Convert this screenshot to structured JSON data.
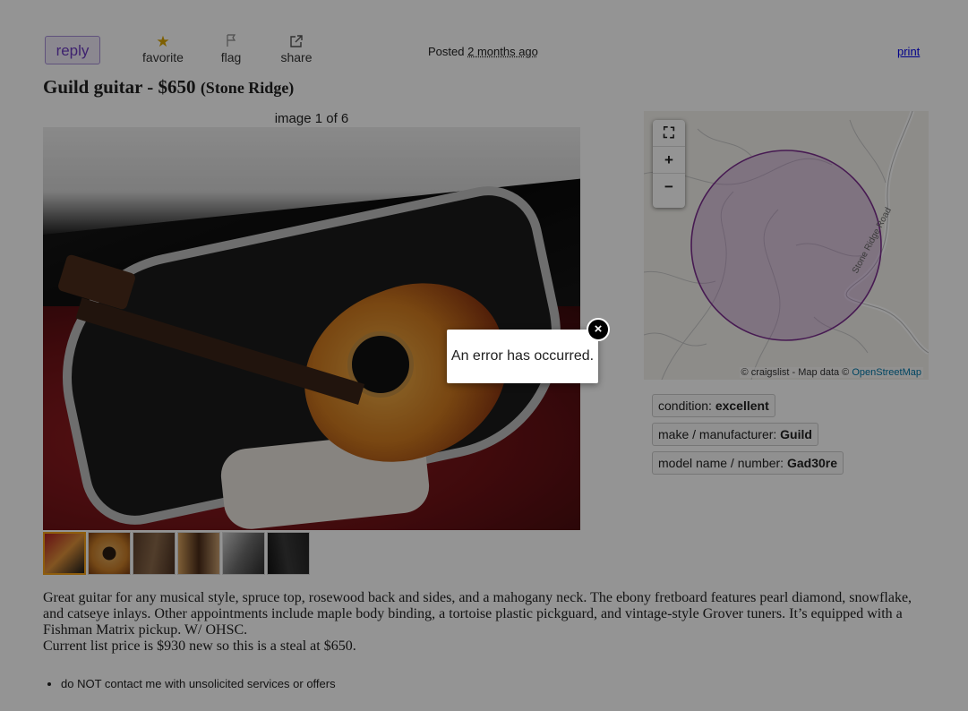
{
  "toolbar": {
    "reply": "reply",
    "favorite": "favorite",
    "flag": "flag",
    "share": "share",
    "posted_label": "Posted",
    "posted_ago": "2 months ago",
    "print": "print"
  },
  "posting": {
    "title": "Guild guitar - $650",
    "location": "(Stone Ridge)"
  },
  "gallery": {
    "counter": "image 1 of 6",
    "thumbnail_count": 6,
    "selected_index": 1
  },
  "map": {
    "road_label": "Stone Ridge Road",
    "attribution_prefix": "© craigslist - Map data ©",
    "attribution_link": "OpenStreetMap",
    "fullscreen_glyph": "⛶",
    "zoom_in_glyph": "+",
    "zoom_out_glyph": "−"
  },
  "attributes": [
    {
      "label": "condition:",
      "value": "excellent"
    },
    {
      "label": "make / manufacturer:",
      "value": "Guild"
    },
    {
      "label": "model name / number:",
      "value": "Gad30re"
    }
  ],
  "description": {
    "paragraph1": "Great guitar for any musical style, spruce top, rosewood back and sides, and a mahogany neck. The ebony fretboard features pearl diamond, snowflake, and catseye inlays. Other appointments include maple body binding, a tortoise plastic pickguard, and vintage-style Grover tuners. It’s equipped with a Fishman Matrix pickup. W/ OHSC.",
    "paragraph2": "Current list price is $930 new so this is a steal at $650."
  },
  "notices": [
    "do NOT contact me with unsolicited services or offers"
  ],
  "error_modal": {
    "message": "An error has occurred.",
    "close_glyph": "×"
  },
  "colors": {
    "accent_purple": "#6b3bbf",
    "link_blue": "#0000ee",
    "favorite_star": "#d9a400",
    "map_circle": "#7a2e8e",
    "overlay": "rgba(0,0,0,0.42)"
  }
}
